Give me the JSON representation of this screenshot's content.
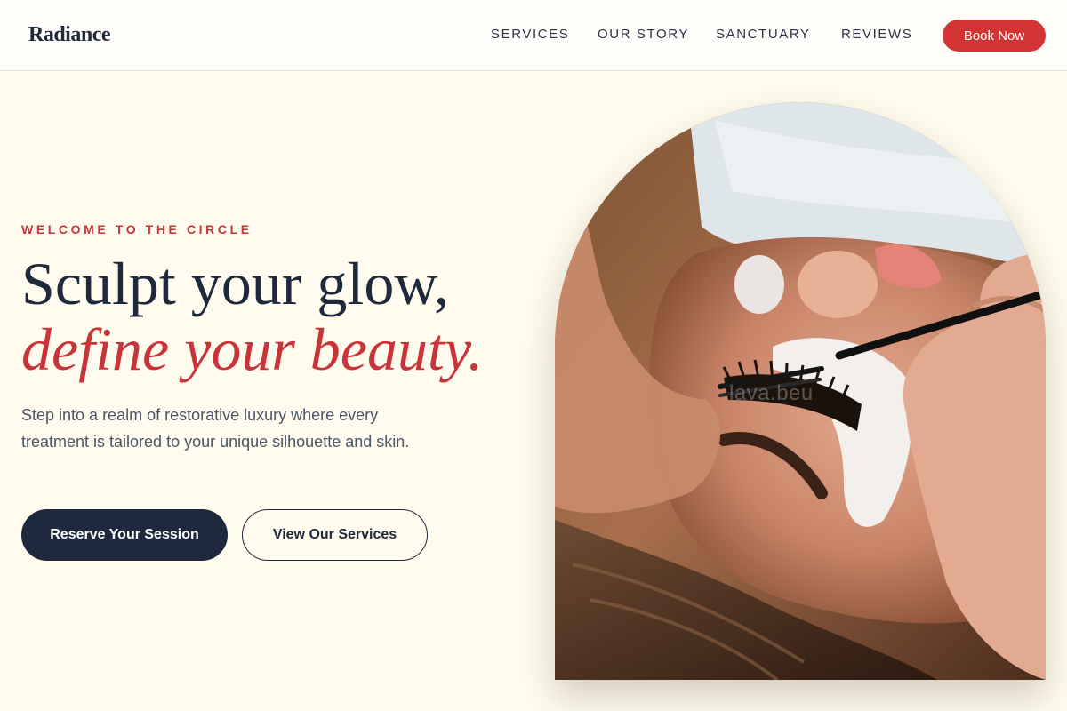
{
  "brand": {
    "logo": "Radiance"
  },
  "nav": {
    "items": [
      {
        "label": "SERVICES"
      },
      {
        "label": "OUR STORY"
      },
      {
        "label": "SANCTUARY"
      },
      {
        "label": "REVIEWS"
      }
    ],
    "cta_label": "Book Now"
  },
  "hero": {
    "eyebrow": "WELCOME TO THE CIRCLE",
    "headline_line1": "Sculpt your glow,",
    "headline_line2": "define your beauty.",
    "description": "Step into a realm of restorative luxury where every treatment is tailored to your unique silhouette and skin.",
    "primary_button": "Reserve Your Session",
    "secondary_button": "View Our Services",
    "image_watermark": "lava.beu"
  },
  "colors": {
    "background": "#fffbee",
    "accent_red": "#d23333",
    "navy": "#1e293d",
    "body_text": "#4a5566"
  }
}
